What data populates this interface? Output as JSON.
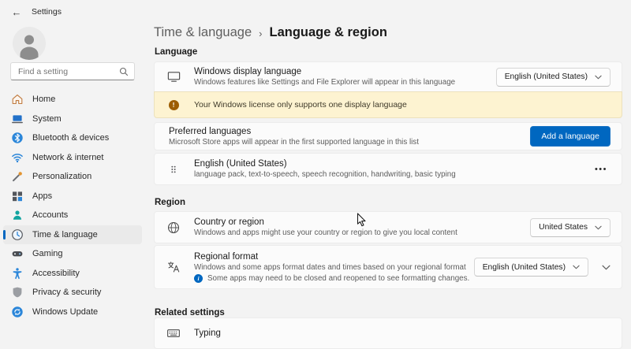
{
  "titlebar": {
    "back_glyph": "←",
    "title": "Settings"
  },
  "sidebar": {
    "search": {
      "placeholder": "Find a setting"
    },
    "items": [
      {
        "label": "Home",
        "icon": "home-icon",
        "selected": false
      },
      {
        "label": "System",
        "icon": "system-icon",
        "selected": false
      },
      {
        "label": "Bluetooth & devices",
        "icon": "bluetooth-icon",
        "selected": false
      },
      {
        "label": "Network & internet",
        "icon": "network-icon",
        "selected": false
      },
      {
        "label": "Personalization",
        "icon": "personalization-icon",
        "selected": false
      },
      {
        "label": "Apps",
        "icon": "apps-icon",
        "selected": false
      },
      {
        "label": "Accounts",
        "icon": "accounts-icon",
        "selected": false
      },
      {
        "label": "Time & language",
        "icon": "time-language-icon",
        "selected": true
      },
      {
        "label": "Gaming",
        "icon": "gaming-icon",
        "selected": false
      },
      {
        "label": "Accessibility",
        "icon": "accessibility-icon",
        "selected": false
      },
      {
        "label": "Privacy & security",
        "icon": "privacy-icon",
        "selected": false
      },
      {
        "label": "Windows Update",
        "icon": "windows-update-icon",
        "selected": false
      }
    ]
  },
  "header": {
    "breadcrumb_parent": "Time & language",
    "breadcrumb_separator": "›",
    "breadcrumb_current": "Language & region"
  },
  "language_section": {
    "header": "Language",
    "display_language": {
      "title": "Windows display language",
      "subtitle": "Windows features like Settings and File Explorer will appear in this language",
      "dropdown_value": "English (United States)"
    },
    "license_warning": {
      "icon_glyph": "!",
      "text": "Your Windows license only supports one display language"
    },
    "preferred_languages": {
      "title": "Preferred languages",
      "subtitle": "Microsoft Store apps will appear in the first supported language in this list",
      "add_button_label": "Add a language"
    },
    "language_item": {
      "title": "English (United States)",
      "subtitle": "language pack, text-to-speech, speech recognition, handwriting, basic typing",
      "menu_glyph": "•••"
    }
  },
  "region_section": {
    "header": "Region",
    "country": {
      "title": "Country or region",
      "subtitle": "Windows and apps might use your country or region to give you local content",
      "dropdown_value": "United States"
    },
    "regional_format": {
      "title": "Regional format",
      "subtitle": "Windows and some apps format dates and times based on your regional format",
      "info_glyph": "i",
      "info_text": "Some apps may need to be closed and reopened to see formatting changes.",
      "dropdown_value": "English (United States)"
    }
  },
  "related_section": {
    "header": "Related settings",
    "typing": {
      "title": "Typing"
    }
  },
  "colors": {
    "accent": "#0067c0",
    "warning_bg": "#fdf3d1",
    "warning_icon": "#9d5d00"
  }
}
